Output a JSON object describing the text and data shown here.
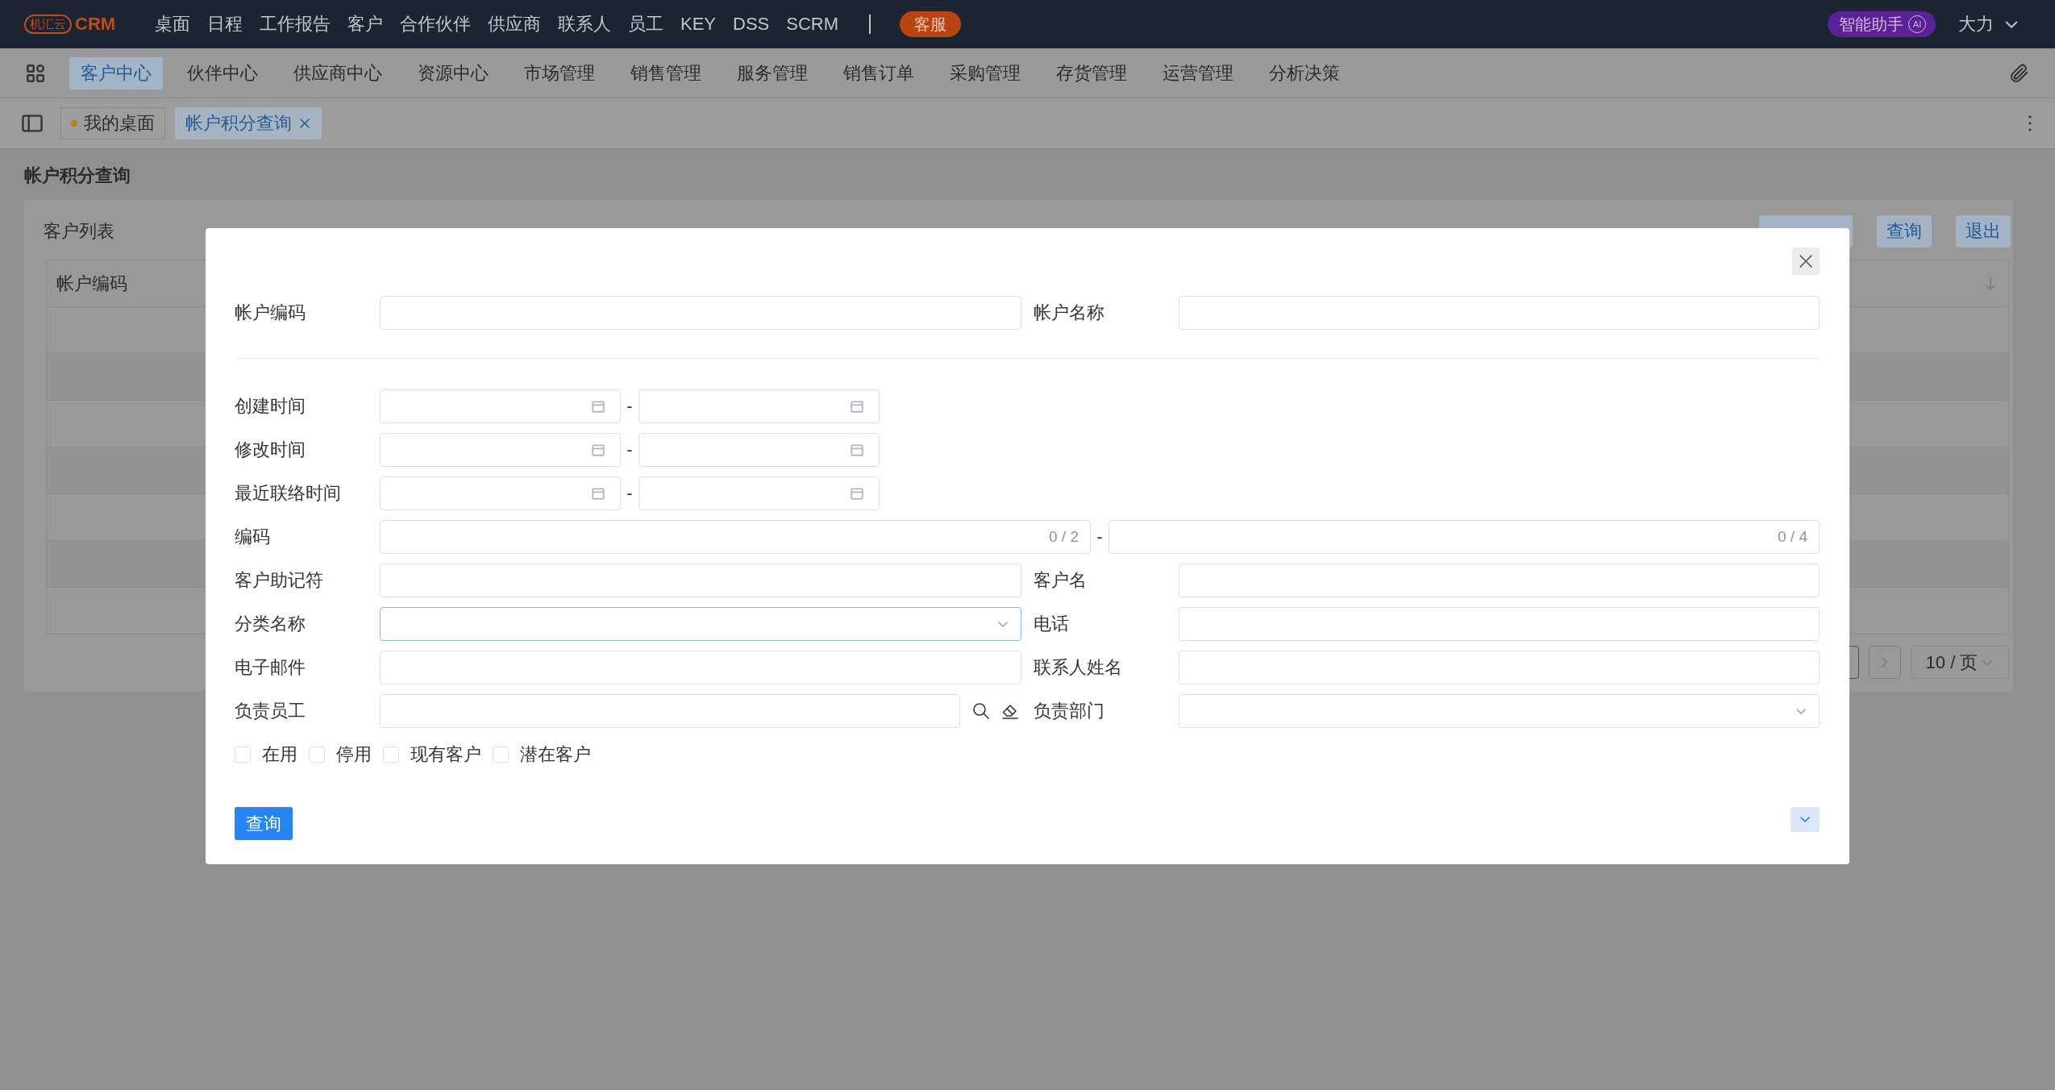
{
  "top_bar": {
    "logo_mark": "机汇云",
    "logo_text": "CRM",
    "menu": [
      "桌面",
      "日程",
      "工作报告",
      "客户",
      "合作伙伴",
      "供应商",
      "联系人",
      "员工",
      "KEY",
      "DSS",
      "SCRM"
    ],
    "service_badge": "客服",
    "ai_assistant": "智能助手",
    "ai_badge": "AI",
    "user": "大力"
  },
  "module_nav": [
    {
      "label": "客户中心",
      "selected": true
    },
    {
      "label": "伙伴中心",
      "selected": false
    },
    {
      "label": "供应商中心",
      "selected": false
    },
    {
      "label": "资源中心",
      "selected": false
    },
    {
      "label": "市场管理",
      "selected": false
    },
    {
      "label": "销售管理",
      "selected": false
    },
    {
      "label": "服务管理",
      "selected": false
    },
    {
      "label": "销售订单",
      "selected": false
    },
    {
      "label": "采购管理",
      "selected": false
    },
    {
      "label": "存货管理",
      "selected": false
    },
    {
      "label": "运营管理",
      "selected": false
    },
    {
      "label": "分析决策",
      "selected": false
    }
  ],
  "page_tabs": [
    {
      "label": "我的桌面",
      "selected": false,
      "closable": false
    },
    {
      "label": "帐户积分查询",
      "selected": true,
      "closable": true
    }
  ],
  "page": {
    "title": "帐户积分查询",
    "card_title": "客户列表",
    "buttons": [
      "查询",
      "退出"
    ],
    "table": {
      "columns": [
        "帐户编码"
      ]
    },
    "pagination": {
      "page_size": "10 / 页"
    }
  },
  "dialog": {
    "rows": [
      {
        "kind": "pair",
        "fields": [
          {
            "label": "帐户编码",
            "kind": "text",
            "focused": false
          },
          {
            "label": "帐户名称",
            "kind": "text",
            "focused": false
          }
        ]
      },
      {
        "kind": "divider"
      },
      {
        "kind": "date_range",
        "label": "创建时间",
        "separator": "-"
      },
      {
        "kind": "date_range",
        "label": "修改时间",
        "separator": "-"
      },
      {
        "kind": "date_range",
        "label": "最近联络时间",
        "separator": "-"
      },
      {
        "kind": "count_range",
        "label": "编码",
        "separator": "-",
        "counters": [
          "0 / 2",
          "0 / 4"
        ]
      },
      {
        "kind": "pair",
        "fields": [
          {
            "label": "客户助记符",
            "kind": "text",
            "focused": false
          },
          {
            "label": "客户名",
            "kind": "text",
            "focused": false
          }
        ]
      },
      {
        "kind": "pair",
        "fields": [
          {
            "label": "分类名称",
            "kind": "select",
            "focused": true
          },
          {
            "label": "电话",
            "kind": "text",
            "focused": false
          }
        ]
      },
      {
        "kind": "pair",
        "fields": [
          {
            "label": "电子邮件",
            "kind": "text",
            "focused": false
          },
          {
            "label": "联系人姓名",
            "kind": "text",
            "focused": false
          }
        ]
      },
      {
        "kind": "pair",
        "fields": [
          {
            "label": "负责员工",
            "kind": "lookup",
            "focused": false
          },
          {
            "label": "负责部门",
            "kind": "select",
            "focused": false
          }
        ]
      }
    ],
    "checkboxes": [
      {
        "label": "在用",
        "checked": false
      },
      {
        "label": "停用",
        "checked": false
      },
      {
        "label": "现有客户",
        "checked": false
      },
      {
        "label": "潜在客户",
        "checked": false
      }
    ],
    "submit": "查询"
  }
}
